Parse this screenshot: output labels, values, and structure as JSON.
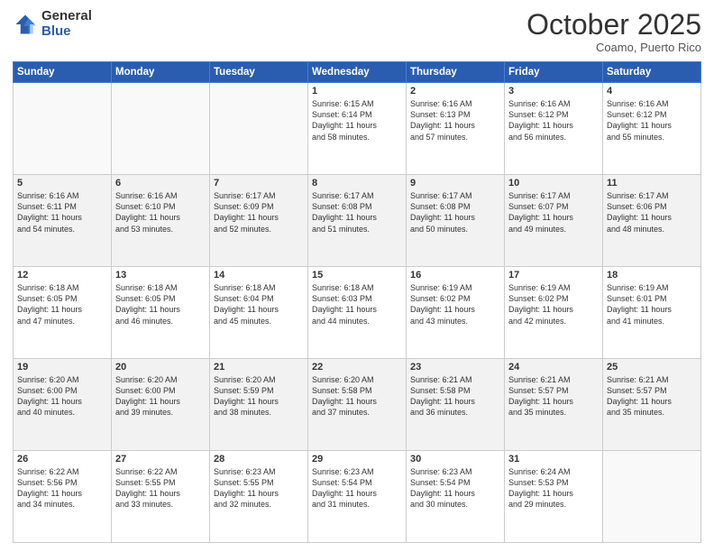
{
  "logo": {
    "general": "General",
    "blue": "Blue"
  },
  "header": {
    "month": "October 2025",
    "location": "Coamo, Puerto Rico"
  },
  "weekdays": [
    "Sunday",
    "Monday",
    "Tuesday",
    "Wednesday",
    "Thursday",
    "Friday",
    "Saturday"
  ],
  "weeks": [
    [
      {
        "day": "",
        "info": ""
      },
      {
        "day": "",
        "info": ""
      },
      {
        "day": "",
        "info": ""
      },
      {
        "day": "1",
        "info": "Sunrise: 6:15 AM\nSunset: 6:14 PM\nDaylight: 11 hours\nand 58 minutes."
      },
      {
        "day": "2",
        "info": "Sunrise: 6:16 AM\nSunset: 6:13 PM\nDaylight: 11 hours\nand 57 minutes."
      },
      {
        "day": "3",
        "info": "Sunrise: 6:16 AM\nSunset: 6:12 PM\nDaylight: 11 hours\nand 56 minutes."
      },
      {
        "day": "4",
        "info": "Sunrise: 6:16 AM\nSunset: 6:12 PM\nDaylight: 11 hours\nand 55 minutes."
      }
    ],
    [
      {
        "day": "5",
        "info": "Sunrise: 6:16 AM\nSunset: 6:11 PM\nDaylight: 11 hours\nand 54 minutes."
      },
      {
        "day": "6",
        "info": "Sunrise: 6:16 AM\nSunset: 6:10 PM\nDaylight: 11 hours\nand 53 minutes."
      },
      {
        "day": "7",
        "info": "Sunrise: 6:17 AM\nSunset: 6:09 PM\nDaylight: 11 hours\nand 52 minutes."
      },
      {
        "day": "8",
        "info": "Sunrise: 6:17 AM\nSunset: 6:08 PM\nDaylight: 11 hours\nand 51 minutes."
      },
      {
        "day": "9",
        "info": "Sunrise: 6:17 AM\nSunset: 6:08 PM\nDaylight: 11 hours\nand 50 minutes."
      },
      {
        "day": "10",
        "info": "Sunrise: 6:17 AM\nSunset: 6:07 PM\nDaylight: 11 hours\nand 49 minutes."
      },
      {
        "day": "11",
        "info": "Sunrise: 6:17 AM\nSunset: 6:06 PM\nDaylight: 11 hours\nand 48 minutes."
      }
    ],
    [
      {
        "day": "12",
        "info": "Sunrise: 6:18 AM\nSunset: 6:05 PM\nDaylight: 11 hours\nand 47 minutes."
      },
      {
        "day": "13",
        "info": "Sunrise: 6:18 AM\nSunset: 6:05 PM\nDaylight: 11 hours\nand 46 minutes."
      },
      {
        "day": "14",
        "info": "Sunrise: 6:18 AM\nSunset: 6:04 PM\nDaylight: 11 hours\nand 45 minutes."
      },
      {
        "day": "15",
        "info": "Sunrise: 6:18 AM\nSunset: 6:03 PM\nDaylight: 11 hours\nand 44 minutes."
      },
      {
        "day": "16",
        "info": "Sunrise: 6:19 AM\nSunset: 6:02 PM\nDaylight: 11 hours\nand 43 minutes."
      },
      {
        "day": "17",
        "info": "Sunrise: 6:19 AM\nSunset: 6:02 PM\nDaylight: 11 hours\nand 42 minutes."
      },
      {
        "day": "18",
        "info": "Sunrise: 6:19 AM\nSunset: 6:01 PM\nDaylight: 11 hours\nand 41 minutes."
      }
    ],
    [
      {
        "day": "19",
        "info": "Sunrise: 6:20 AM\nSunset: 6:00 PM\nDaylight: 11 hours\nand 40 minutes."
      },
      {
        "day": "20",
        "info": "Sunrise: 6:20 AM\nSunset: 6:00 PM\nDaylight: 11 hours\nand 39 minutes."
      },
      {
        "day": "21",
        "info": "Sunrise: 6:20 AM\nSunset: 5:59 PM\nDaylight: 11 hours\nand 38 minutes."
      },
      {
        "day": "22",
        "info": "Sunrise: 6:20 AM\nSunset: 5:58 PM\nDaylight: 11 hours\nand 37 minutes."
      },
      {
        "day": "23",
        "info": "Sunrise: 6:21 AM\nSunset: 5:58 PM\nDaylight: 11 hours\nand 36 minutes."
      },
      {
        "day": "24",
        "info": "Sunrise: 6:21 AM\nSunset: 5:57 PM\nDaylight: 11 hours\nand 35 minutes."
      },
      {
        "day": "25",
        "info": "Sunrise: 6:21 AM\nSunset: 5:57 PM\nDaylight: 11 hours\nand 35 minutes."
      }
    ],
    [
      {
        "day": "26",
        "info": "Sunrise: 6:22 AM\nSunset: 5:56 PM\nDaylight: 11 hours\nand 34 minutes."
      },
      {
        "day": "27",
        "info": "Sunrise: 6:22 AM\nSunset: 5:55 PM\nDaylight: 11 hours\nand 33 minutes."
      },
      {
        "day": "28",
        "info": "Sunrise: 6:23 AM\nSunset: 5:55 PM\nDaylight: 11 hours\nand 32 minutes."
      },
      {
        "day": "29",
        "info": "Sunrise: 6:23 AM\nSunset: 5:54 PM\nDaylight: 11 hours\nand 31 minutes."
      },
      {
        "day": "30",
        "info": "Sunrise: 6:23 AM\nSunset: 5:54 PM\nDaylight: 11 hours\nand 30 minutes."
      },
      {
        "day": "31",
        "info": "Sunrise: 6:24 AM\nSunset: 5:53 PM\nDaylight: 11 hours\nand 29 minutes."
      },
      {
        "day": "",
        "info": ""
      }
    ]
  ]
}
